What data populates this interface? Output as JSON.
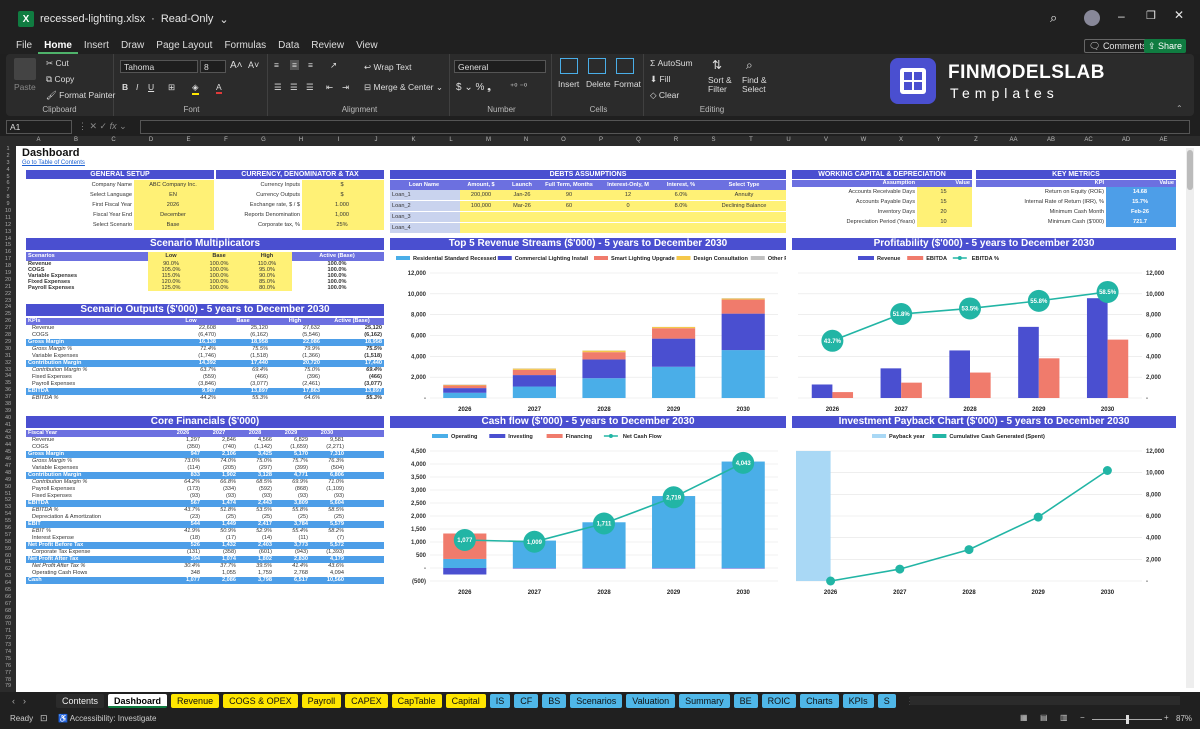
{
  "window": {
    "filename": "recessed-lighting.xlsx",
    "mode": "Read-Only"
  },
  "menu": [
    "File",
    "Home",
    "Insert",
    "Draw",
    "Page Layout",
    "Formulas",
    "Data",
    "Review",
    "View"
  ],
  "top_buttons": {
    "comments": "Comments",
    "share": "Share"
  },
  "ribbon": {
    "clipboard": {
      "paste": "Paste",
      "cut": "Cut",
      "copy": "Copy",
      "format_painter": "Format Painter",
      "label": "Clipboard"
    },
    "font": {
      "family": "Tahoma",
      "size": "8",
      "label": "Font"
    },
    "alignment": {
      "wrap": "Wrap Text",
      "merge": "Merge & Center",
      "label": "Alignment"
    },
    "number": {
      "format": "General",
      "label": "Number"
    },
    "cells": {
      "insert": "Insert",
      "delete": "Delete",
      "format": "Format",
      "label": "Cells"
    },
    "editing": {
      "autosum": "AutoSum",
      "fill": "Fill",
      "clear": "Clear",
      "sort": "Sort & Filter",
      "find": "Find & Select",
      "label": "Editing"
    }
  },
  "brand": {
    "name": "FINMODELSLAB",
    "sub": "Templates"
  },
  "formula": {
    "namebox": "A1",
    "fx": "fx"
  },
  "columns": [
    "A",
    "B",
    "C",
    "D",
    "E",
    "F",
    "G",
    "H",
    "I",
    "J",
    "K",
    "L",
    "M",
    "N",
    "O",
    "P",
    "Q",
    "R",
    "S",
    "T",
    "U",
    "V",
    "W",
    "X",
    "Y",
    "Z",
    "AA",
    "AB",
    "AC",
    "AD",
    "AE"
  ],
  "dashboard": {
    "title": "Dashboard",
    "link": "Go to Table of Contents"
  },
  "general_setup": {
    "title": "GENERAL SETUP",
    "rows": [
      [
        "Company Name",
        "ABC Company Inc."
      ],
      [
        "Select Language",
        "EN"
      ],
      [
        "First Fiscal Year",
        "2026"
      ],
      [
        "Fiscal Year End",
        "December"
      ],
      [
        "Select Scenario",
        "Base"
      ]
    ]
  },
  "currency": {
    "title": "CURRENCY, DENOMINATOR & TAX",
    "rows": [
      [
        "Currency Inputs",
        "$"
      ],
      [
        "Currency Outputs",
        "$"
      ],
      [
        "Exchange rate, $ / $",
        "1.000"
      ],
      [
        "Reports Denomination",
        "1,000"
      ],
      [
        "Corporate tax, %",
        "25%"
      ]
    ]
  },
  "debts": {
    "title": "DEBTS ASSUMPTIONS",
    "headers": [
      "Loan Name",
      "Amount, $",
      "Launch",
      "Full Term, Months",
      "Interest-Only, M",
      "Interest, %",
      "Select Type"
    ],
    "rows": [
      [
        "Loan_1",
        "200,000",
        "Jan-26",
        "90",
        "12",
        "6.0%",
        "Annuity"
      ],
      [
        "Loan_2",
        "100,000",
        "Mar-26",
        "60",
        "0",
        "8.0%",
        "Declining Balance"
      ],
      [
        "Loan_3",
        "",
        "",
        "",
        "",
        "",
        ""
      ],
      [
        "Loan_4",
        "",
        "",
        "",
        "",
        "",
        ""
      ]
    ]
  },
  "working_capital": {
    "title": "WORKING CAPITAL & DEPRECIATION",
    "headers": [
      "Assumption",
      "Value"
    ],
    "rows": [
      [
        "Accounts Receivable Days",
        "15"
      ],
      [
        "Accounts Payable Days",
        "15"
      ],
      [
        "Inventory Days",
        "20"
      ],
      [
        "Depreciation Period (Years)",
        "10"
      ]
    ]
  },
  "kpis": {
    "title": "KEY METRICS",
    "headers": [
      "KPI",
      "Value"
    ],
    "rows": [
      [
        "Return on Equity (ROE)",
        "14.68"
      ],
      [
        "Internal Rate of Return (IRR), %",
        "15.7%"
      ],
      [
        "Minimum Cash Month",
        "Feb-26"
      ],
      [
        "Minimum Cash ($'000)",
        "721.7"
      ]
    ]
  },
  "scenario_mult": {
    "title": "Scenario Multiplicators",
    "headers": [
      "Scenarios",
      "Low",
      "Base",
      "High",
      "Active (Base)"
    ],
    "rows": [
      [
        "Revenue",
        "90.0%",
        "100.0%",
        "110.0%",
        "100.0%"
      ],
      [
        "COGS",
        "105.0%",
        "100.0%",
        "95.0%",
        "100.0%"
      ],
      [
        "Variable Expenses",
        "115.0%",
        "100.0%",
        "90.0%",
        "100.0%"
      ],
      [
        "Fixed Expenses",
        "120.0%",
        "100.0%",
        "85.0%",
        "100.0%"
      ],
      [
        "Payroll Expenses",
        "125.0%",
        "100.0%",
        "80.0%",
        "100.0%"
      ]
    ]
  },
  "scenario_out": {
    "title": "Scenario Outputs ($'000) - 5 years to December 2030",
    "headers": [
      "KPIs",
      "Low",
      "Base",
      "High",
      "Active (Base)"
    ],
    "rows": [
      [
        "Revenue",
        "22,608",
        "25,120",
        "27,632",
        "25,120",
        ""
      ],
      [
        "COGS",
        "(6,470)",
        "(6,162)",
        "(5,546)",
        "(6,162)",
        ""
      ],
      [
        "Gross Margin",
        "16,138",
        "18,958",
        "22,086",
        "18,958",
        "hl"
      ],
      [
        "Gross Margin %",
        "71.4%",
        "75.5%",
        "79.9%",
        "75.5%",
        "i"
      ],
      [
        "Variable Expenses",
        "(1,746)",
        "(1,518)",
        "(1,366)",
        "(1,518)",
        ""
      ],
      [
        "Contribution Margin",
        "14,392",
        "17,440",
        "20,720",
        "17,440",
        "hl"
      ],
      [
        "Contribution Margin %",
        "63.7%",
        "69.4%",
        "75.0%",
        "69.4%",
        "i"
      ],
      [
        "Fixed Expenses",
        "(559)",
        "(466)",
        "(396)",
        "(466)",
        ""
      ],
      [
        "Payroll Expenses",
        "(3,846)",
        "(3,077)",
        "(2,461)",
        "(3,077)",
        ""
      ],
      [
        "EBITDA",
        "9,987",
        "13,897",
        "17,863",
        "13,897",
        "hl"
      ],
      [
        "EBITDA %",
        "44.2%",
        "55.3%",
        "64.6%",
        "55.3%",
        "i"
      ]
    ]
  },
  "core": {
    "title": "Core Financials ($'000)",
    "headers": [
      "Fiscal Year",
      "2026",
      "2027",
      "2028",
      "2029",
      "2030"
    ],
    "rows": [
      [
        "Revenue",
        "1,297",
        "2,846",
        "4,566",
        "6,829",
        "9,581",
        ""
      ],
      [
        "COGS",
        "(350)",
        "(740)",
        "(1,142)",
        "(1,659)",
        "(2,271)",
        ""
      ],
      [
        "Gross Margin",
        "947",
        "2,106",
        "3,425",
        "5,170",
        "7,310",
        "hl"
      ],
      [
        "Gross Margin %",
        "73.0%",
        "74.0%",
        "75.0%",
        "75.7%",
        "76.3%",
        "i"
      ],
      [
        "Variable Expenses",
        "(114)",
        "(205)",
        "(297)",
        "(399)",
        "(504)",
        ""
      ],
      [
        "Contribution Margin",
        "833",
        "1,902",
        "3,128",
        "4,771",
        "6,806",
        "hl"
      ],
      [
        "Contribution Margin %",
        "64.2%",
        "66.8%",
        "68.5%",
        "69.9%",
        "71.0%",
        "i"
      ],
      [
        "Payroll Expenses",
        "(173)",
        "(334)",
        "(592)",
        "(868)",
        "(1,109)",
        ""
      ],
      [
        "Fixed Expenses",
        "(93)",
        "(93)",
        "(93)",
        "(93)",
        "(93)",
        ""
      ],
      [
        "EBITDA",
        "567",
        "1,474",
        "2,443",
        "3,809",
        "5,604",
        "hl"
      ],
      [
        "EBITDA %",
        "43.7%",
        "51.8%",
        "53.5%",
        "55.8%",
        "58.5%",
        "i"
      ],
      [
        "Depreciation & Amortization",
        "(23)",
        "(25)",
        "(25)",
        "(25)",
        "(25)",
        ""
      ],
      [
        "EBIT",
        "544",
        "1,449",
        "2,417",
        "3,784",
        "5,579",
        "hl"
      ],
      [
        "EBIT %",
        "41.9%",
        "50.9%",
        "52.9%",
        "55.4%",
        "58.2%",
        "i"
      ],
      [
        "Interest Expense",
        "(18)",
        "(17)",
        "(14)",
        "(11)",
        "(7)",
        ""
      ],
      [
        "Net Profit Before Tax",
        "526",
        "1,432",
        "2,403",
        "3,773",
        "5,572",
        "hl"
      ],
      [
        "Corporate Tax Expense",
        "(131)",
        "(358)",
        "(601)",
        "(943)",
        "(1,393)",
        ""
      ],
      [
        "Net Profit After Tax",
        "394",
        "1,074",
        "1,802",
        "2,830",
        "4,179",
        "hl"
      ],
      [
        "Net Profit After Tax %",
        "30.4%",
        "37.7%",
        "39.5%",
        "41.4%",
        "43.6%",
        "i"
      ],
      [
        "Operating Cash Flows",
        "348",
        "1,055",
        "1,759",
        "2,768",
        "4,094",
        ""
      ],
      [
        "Cash",
        "1,077",
        "2,086",
        "3,798",
        "6,517",
        "10,560",
        "hl"
      ]
    ]
  },
  "sheet_tabs": [
    {
      "label": "Contents",
      "c": "white"
    },
    {
      "label": "Dashboard",
      "c": "active"
    },
    {
      "label": "Revenue",
      "c": "yellow"
    },
    {
      "label": "COGS & OPEX",
      "c": "yellow"
    },
    {
      "label": "Payroll",
      "c": "yellow"
    },
    {
      "label": "CAPEX",
      "c": "yellow"
    },
    {
      "label": "CapTable",
      "c": "yellow"
    },
    {
      "label": "Capital",
      "c": "yellow"
    },
    {
      "label": "IS",
      "c": "blue"
    },
    {
      "label": "CF",
      "c": "blue"
    },
    {
      "label": "BS",
      "c": "blue"
    },
    {
      "label": "Scenarios",
      "c": "blue"
    },
    {
      "label": "Valuation",
      "c": "blue"
    },
    {
      "label": "Summary",
      "c": "blue"
    },
    {
      "label": "BE",
      "c": "blue"
    },
    {
      "label": "ROIC",
      "c": "blue"
    },
    {
      "label": "Charts",
      "c": "blue"
    },
    {
      "label": "KPIs",
      "c": "blue"
    },
    {
      "label": "S",
      "c": "blue"
    }
  ],
  "status": {
    "ready": "Ready",
    "accessibility": "Accessibility: Investigate",
    "zoom": "87%"
  },
  "chart_data": [
    {
      "type": "bar",
      "title": "Top 5 Revenue Streams ($'000) - 5 years to December 2030",
      "categories": [
        "2026",
        "2027",
        "2028",
        "2029",
        "2030"
      ],
      "stacked": true,
      "ylim": [
        0,
        12000
      ],
      "yticks": [
        "12,000",
        "10,000",
        "8,000",
        "6,000",
        "4,000",
        "2,000",
        "-"
      ],
      "series": [
        {
          "name": "Residential Standard Recessed",
          "color": "#4aaee8",
          "values": [
            500,
            1100,
            1900,
            3000,
            4600
          ]
        },
        {
          "name": "Commercial Lighting Install",
          "color": "#4a4fd0",
          "values": [
            450,
            1100,
            1800,
            2700,
            3500
          ]
        },
        {
          "name": "Smart Lighting Upgrade",
          "color": "#f07b6c",
          "values": [
            250,
            500,
            700,
            1000,
            1350
          ]
        },
        {
          "name": "Design Consultation",
          "color": "#f5c84a",
          "values": [
            60,
            120,
            150,
            120,
            100
          ]
        },
        {
          "name": "Other Revenue",
          "color": "#c0c0c0",
          "values": [
            37,
            26,
            16,
            9,
            31
          ]
        }
      ]
    },
    {
      "type": "bar",
      "title": "Profitability ($'000) - 5 years to December 2030",
      "categories": [
        "2026",
        "2027",
        "2028",
        "2029",
        "2030"
      ],
      "ylim": [
        0,
        12000
      ],
      "yticks": [
        "12,000",
        "10,000",
        "8,000",
        "6,000",
        "4,000",
        "2,000",
        "-"
      ],
      "series": [
        {
          "name": "Revenue",
          "color": "#4a4fd0",
          "values": [
            1297,
            2846,
            4566,
            6829,
            9581
          ]
        },
        {
          "name": "EBITDA",
          "color": "#f07b6c",
          "values": [
            567,
            1474,
            2443,
            3809,
            5604
          ]
        },
        {
          "name": "EBITDA %",
          "color": "#22b5a5",
          "line": true,
          "labels": [
            "43.7%",
            "51.8%",
            "53.5%",
            "55.8%",
            "58.5%"
          ],
          "values": [
            43.7,
            51.8,
            53.5,
            55.8,
            58.5
          ]
        }
      ]
    },
    {
      "type": "bar",
      "title": "Cash flow ($'000) - 5 years to December 2030",
      "categories": [
        "2026",
        "2027",
        "2028",
        "2029",
        "2030"
      ],
      "stacked": true,
      "ylim": [
        -500,
        4500
      ],
      "yticks": [
        "4,500",
        "4,000",
        "3,500",
        "3,000",
        "2,500",
        "2,000",
        "1,500",
        "1,000",
        "500",
        "-",
        "(500)"
      ],
      "series": [
        {
          "name": "Operating",
          "color": "#4aaee8",
          "values": [
            348,
            1055,
            1759,
            2768,
            4094
          ]
        },
        {
          "name": "Investing",
          "color": "#4a4fd0",
          "values": [
            -250,
            -20,
            -20,
            -20,
            -20
          ]
        },
        {
          "name": "Financing",
          "color": "#f07b6c",
          "values": [
            979,
            0,
            0,
            0,
            0
          ]
        },
        {
          "name": "Net Cash Flow",
          "color": "#22b5a5",
          "line": true,
          "labels": [
            "1,077",
            "1,009",
            "1,711",
            "2,719",
            "4,043"
          ],
          "values": [
            1077,
            1009,
            1711,
            2719,
            4043
          ]
        }
      ]
    },
    {
      "type": "line",
      "title": "Investment Payback Chart ($'000) - 5 years to December 2030",
      "categories": [
        "2026",
        "2027",
        "2028",
        "2029",
        "2030"
      ],
      "ylim": [
        0,
        12000
      ],
      "yticks": [
        "12,000",
        "10,000",
        "8,000",
        "6,000",
        "4,000",
        "2,000",
        "-"
      ],
      "series": [
        {
          "name": "Payback year",
          "color": "#a9d8f5",
          "values": [
            1,
            0,
            0,
            0,
            0
          ]
        },
        {
          "name": "Cumulative Cash Generated (Spent)",
          "color": "#22b5a5",
          "values": [
            0,
            1100,
            2900,
            5900,
            10200
          ]
        }
      ]
    }
  ]
}
